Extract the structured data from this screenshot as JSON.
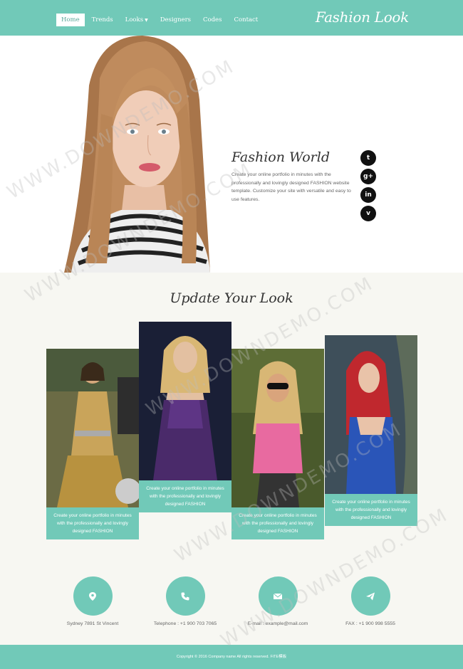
{
  "nav": {
    "items": [
      {
        "label": "Home",
        "active": true
      },
      {
        "label": "Trends"
      },
      {
        "label": "Looks",
        "dropdown": true
      },
      {
        "label": "Designers"
      },
      {
        "label": "Codes"
      },
      {
        "label": "Contact"
      }
    ],
    "brand": "Fashion Look"
  },
  "hero": {
    "title": "Fashion World",
    "text": "Create your online portfolio in minutes with the professionally and lovingly designed FASHION website template. Customize your site with versatile and easy to use features.",
    "social": [
      "twitter-icon",
      "google-plus-icon",
      "linkedin-icon",
      "vimeo-icon"
    ],
    "social_glyphs": [
      "t",
      "g+",
      "in",
      "v"
    ]
  },
  "section": {
    "title": "Update Your Look",
    "cards": [
      {
        "caption": "Create your online portfolio in minutes with the professionally and lovingly designed FASHION"
      },
      {
        "caption": "Create your online portfolio in minutes with the professionally and lovingly designed FASHION"
      },
      {
        "caption": "Create your online portfolio in minutes with the professionally and lovingly designed FASHION"
      },
      {
        "caption": "Create your online portfolio in minutes with the professionally and lovingly designed FASHION"
      }
    ]
  },
  "contact": {
    "items": [
      {
        "icon": "location-pin-icon",
        "text": "Sydney 7891 St Vincent"
      },
      {
        "icon": "phone-icon",
        "text": "Telephone : +1 900 703 7065"
      },
      {
        "icon": "envelope-icon",
        "text": "E-mail : example@mail.com"
      },
      {
        "icon": "paper-plane-icon",
        "text": "FAX : +1 900 998 5555"
      }
    ]
  },
  "footer": {
    "text": "Copyright © 2016 Company name All rights reserved. FiTE模板"
  },
  "watermark": "WWW.DOWNDEMO.COM",
  "colors": {
    "accent": "#71c9b8",
    "footer": "#71c9b8",
    "background": "#f7f7f2"
  }
}
